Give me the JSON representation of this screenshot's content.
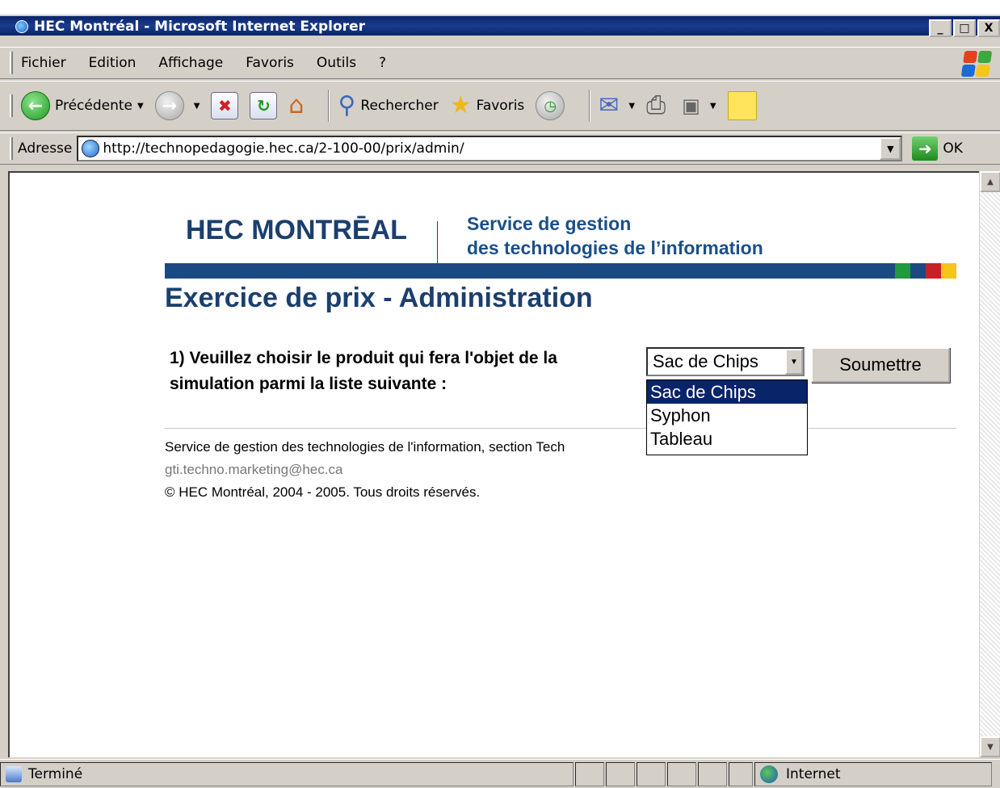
{
  "window": {
    "title": "HEC Montréal - Microsoft Internet Explorer",
    "buttons": [
      "_",
      "□",
      "X"
    ]
  },
  "menu": {
    "items": [
      "Fichier",
      "Edition",
      "Affichage",
      "Favoris",
      "Outils",
      "?"
    ]
  },
  "toolbar": {
    "back_label": "Précédente",
    "search_label": "Rechercher",
    "favorites_label": "Favoris"
  },
  "address": {
    "label": "Adresse",
    "url": "http://technopedagogie.hec.ca/2-100-00/prix/admin/",
    "go_label": "OK"
  },
  "page": {
    "logo_text": "HEC MONTRĒAL",
    "service_line1": "Service de gestion",
    "service_line2": "des technologies de l’information",
    "title": "Exercice de prix - Administration",
    "question": "1) Veuillez choisir le produit qui fera l'objet de la simulation parmi la liste suivante :",
    "select_value": "Sac de Chips",
    "submit_label": "Soumettre",
    "options": [
      "Sac de Chips",
      "Syphon",
      "Tableau"
    ],
    "footer_line1": "Service de gestion des technologies de l'information, section Tech",
    "footer_email": "gti.techno.marketing@hec.ca",
    "footer_copyright": "© HEC Montréal, 2004 - 2005. Tous droits réservés.",
    "colors": {
      "brand_blue": "#1b4a82",
      "stripe_green": "#1f9a3c",
      "stripe_blue": "#1b4a82",
      "stripe_red": "#c8202a",
      "stripe_yellow": "#f5c518"
    }
  },
  "status": {
    "left_text": "Terminé",
    "zone_text": "Internet"
  }
}
